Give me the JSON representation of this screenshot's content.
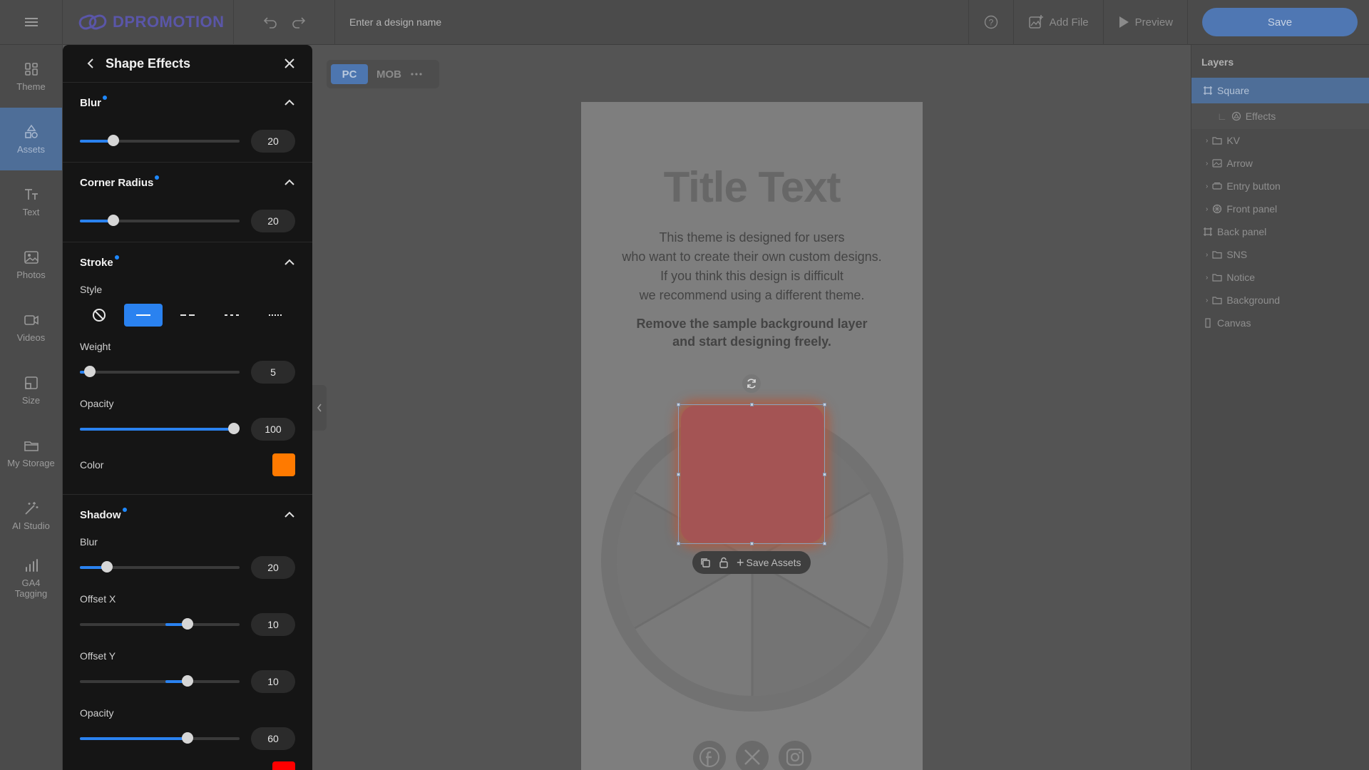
{
  "app": {
    "logo_text": "DPROMOTION",
    "design_name_placeholder": "Enter a design name"
  },
  "toolbar": {
    "add_file_label": "Add File",
    "preview_label": "Preview",
    "save_label": "Save"
  },
  "nav": {
    "items": [
      {
        "label": "Theme",
        "icon": "theme-icon"
      },
      {
        "label": "Assets",
        "icon": "assets-icon"
      },
      {
        "label": "Text",
        "icon": "text-icon"
      },
      {
        "label": "Photos",
        "icon": "photos-icon"
      },
      {
        "label": "Videos",
        "icon": "videos-icon"
      },
      {
        "label": "Size",
        "icon": "size-icon"
      },
      {
        "label": "My Storage",
        "icon": "folder-icon"
      },
      {
        "label": "AI Studio",
        "icon": "magic-wand-icon"
      },
      {
        "label": "GA4 Tagging",
        "icon": "chart-icon"
      }
    ],
    "active": "Assets"
  },
  "panel": {
    "title": "Shape Effects",
    "blur": {
      "title": "Blur",
      "value": "20"
    },
    "corner_radius": {
      "title": "Corner Radius",
      "value": "20"
    },
    "stroke": {
      "title": "Stroke",
      "style_label": "Style",
      "style_options": [
        "none",
        "solid",
        "dashed",
        "dash-dot",
        "dotted"
      ],
      "active_style": "solid",
      "weight_label": "Weight",
      "weight_value": "5",
      "opacity_label": "Opacity",
      "opacity_value": "100",
      "color_label": "Color",
      "color": "#ff7a00"
    },
    "shadow": {
      "title": "Shadow",
      "blur_label": "Blur",
      "blur_value": "20",
      "offset_x_label": "Offset X",
      "offset_x_value": "10",
      "offset_y_label": "Offset Y",
      "offset_y_value": "10",
      "opacity_label": "Opacity",
      "opacity_value": "60",
      "color": "#ff0000"
    }
  },
  "device": {
    "pc": "PC",
    "mob": "MOB",
    "active": "PC"
  },
  "canvas": {
    "title": "Title Text",
    "body_lines": [
      "This theme is designed for users",
      "who want to create their own custom designs.",
      "If you think this design is difficult",
      "we recommend using a different theme."
    ],
    "bold_lines": [
      "Remove the sample background layer",
      "and start designing freely."
    ],
    "save_assets_label": "Save Assets"
  },
  "layers": {
    "title": "Layers",
    "items": [
      {
        "label": "Square",
        "icon": "frame-icon",
        "selected": true
      },
      {
        "label": "Effects",
        "icon": "effects-icon",
        "sub": true
      },
      {
        "label": "KV",
        "icon": "folder-icon"
      },
      {
        "label": "Arrow",
        "icon": "image-icon"
      },
      {
        "label": "Entry button",
        "icon": "button-icon"
      },
      {
        "label": "Front panel",
        "icon": "wheel-icon"
      },
      {
        "label": "Back panel",
        "icon": "frame-icon"
      },
      {
        "label": "SNS",
        "icon": "folder-icon"
      },
      {
        "label": "Notice",
        "icon": "folder-icon"
      },
      {
        "label": "Background",
        "icon": "folder-icon"
      },
      {
        "label": "Canvas",
        "icon": "page-icon"
      }
    ]
  },
  "colors": {
    "accent": "#2a82f0",
    "nav_active": "#4e6e98",
    "save": "#4f77b3"
  }
}
